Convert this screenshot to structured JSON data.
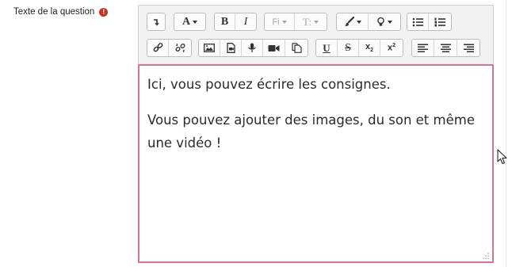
{
  "field": {
    "label": "Texte de la question",
    "required_icon": "exclamation-circle-icon",
    "required_color": "#ca3120"
  },
  "toolbar": {
    "font_family_label": "Fi",
    "font_size_label": "T:",
    "bold_label": "B",
    "italic_label": "I",
    "underline_label": "U",
    "strike_label": "S",
    "subscript_label": "x",
    "subscript_sub": "2",
    "superscript_label": "x",
    "superscript_sup": "2",
    "font_color_label": "A"
  },
  "content": {
    "paragraphs": [
      "Ici, vous pouvez écrire les consignes.",
      "Vous pouvez ajouter des images, du son et même une vidéo !"
    ]
  },
  "colors": {
    "focus_border": "#d1758f",
    "toolbar_bg": "#f2f2f2"
  }
}
